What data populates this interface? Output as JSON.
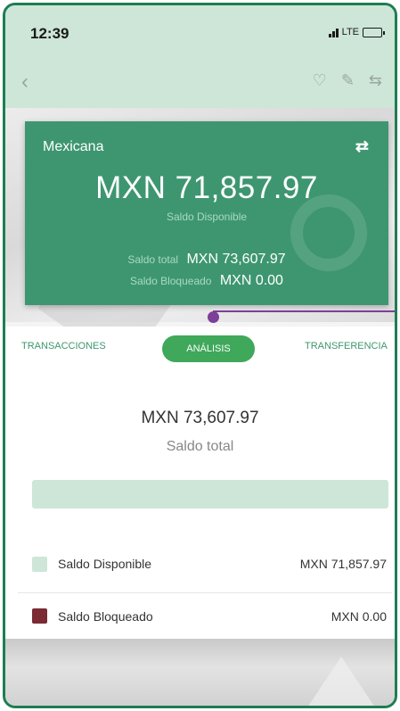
{
  "status": {
    "time": "12:39",
    "network": "LTE"
  },
  "card": {
    "name": "Mexicana",
    "amount": "MXN 71,857.97",
    "available_label": "Saldo Disponible",
    "total_label": "Saldo total",
    "total_value": "MXN 73,607.97",
    "blocked_label": "Saldo Bloqueado",
    "blocked_value": "MXN 0.00"
  },
  "tabs": [
    {
      "label": "TRANSACCIONES"
    },
    {
      "label": "ANÁLISIS"
    },
    {
      "label": "TRANSFERENCIA"
    }
  ],
  "analysis": {
    "total_amount": "MXN 73,607.97",
    "total_label": "Saldo total",
    "legend": [
      {
        "label": "Saldo Disponible",
        "value": "MXN 71,857.97",
        "color": "#cde6d8"
      },
      {
        "label": "Saldo Bloqueado",
        "value": "MXN 0.00",
        "color": "#7a2b33"
      }
    ]
  },
  "colors": {
    "brand": "#3e9670",
    "accent": "#3fa85a",
    "callout": "#7d3f98"
  },
  "icons": [
    "back-icon",
    "heart-icon",
    "edit-icon",
    "transfer-icon",
    "swap-icon"
  ]
}
